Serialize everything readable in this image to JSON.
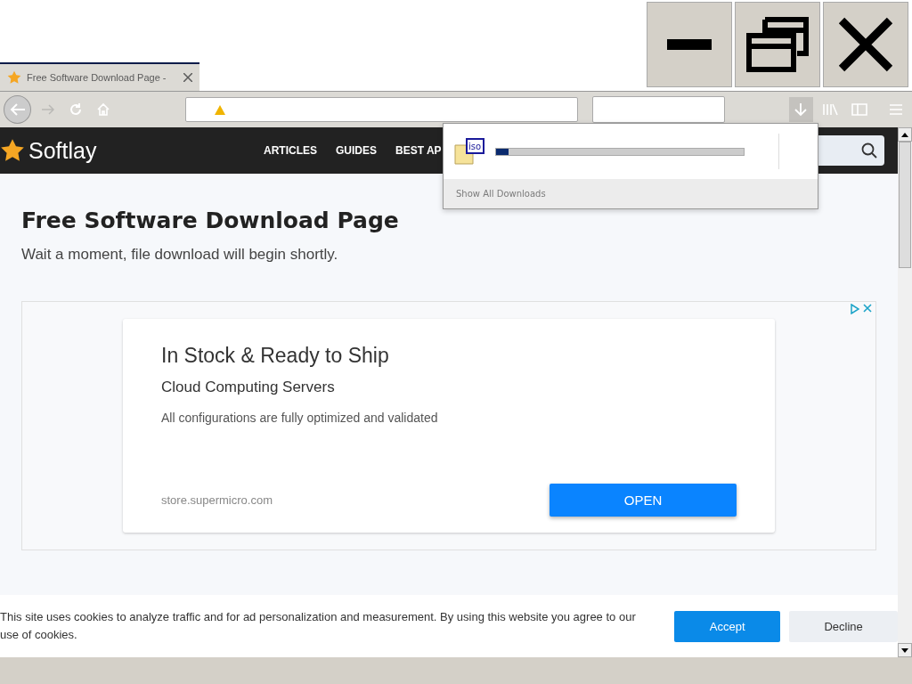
{
  "tab": {
    "title": "Free Software Download Page -",
    "selected": true
  },
  "toolbar": {
    "back_disabled": false,
    "forward_disabled": true
  },
  "site": {
    "name": "Softlay",
    "nav": [
      "ARTICLES",
      "GUIDES",
      "BEST AP"
    ]
  },
  "page": {
    "title": "Free Software Download Page",
    "subtitle": "Wait a moment, file download will begin shortly."
  },
  "ad": {
    "headline": "In Stock & Ready to Ship",
    "subhead": "Cloud Computing Servers",
    "body": "All configurations are fully optimized and validated",
    "domain": "store.supermicro.com",
    "button": "OPEN"
  },
  "cookie_bar": {
    "text": "This site uses cookies to analyze traffic and for ad personalization and measurement. By using this website you agree to our use of cookies.",
    "accept": "Accept",
    "decline": "Decline"
  },
  "downloads_panel": {
    "file_type": "iso",
    "level": 0.05,
    "footer": "Show All Downloads"
  }
}
